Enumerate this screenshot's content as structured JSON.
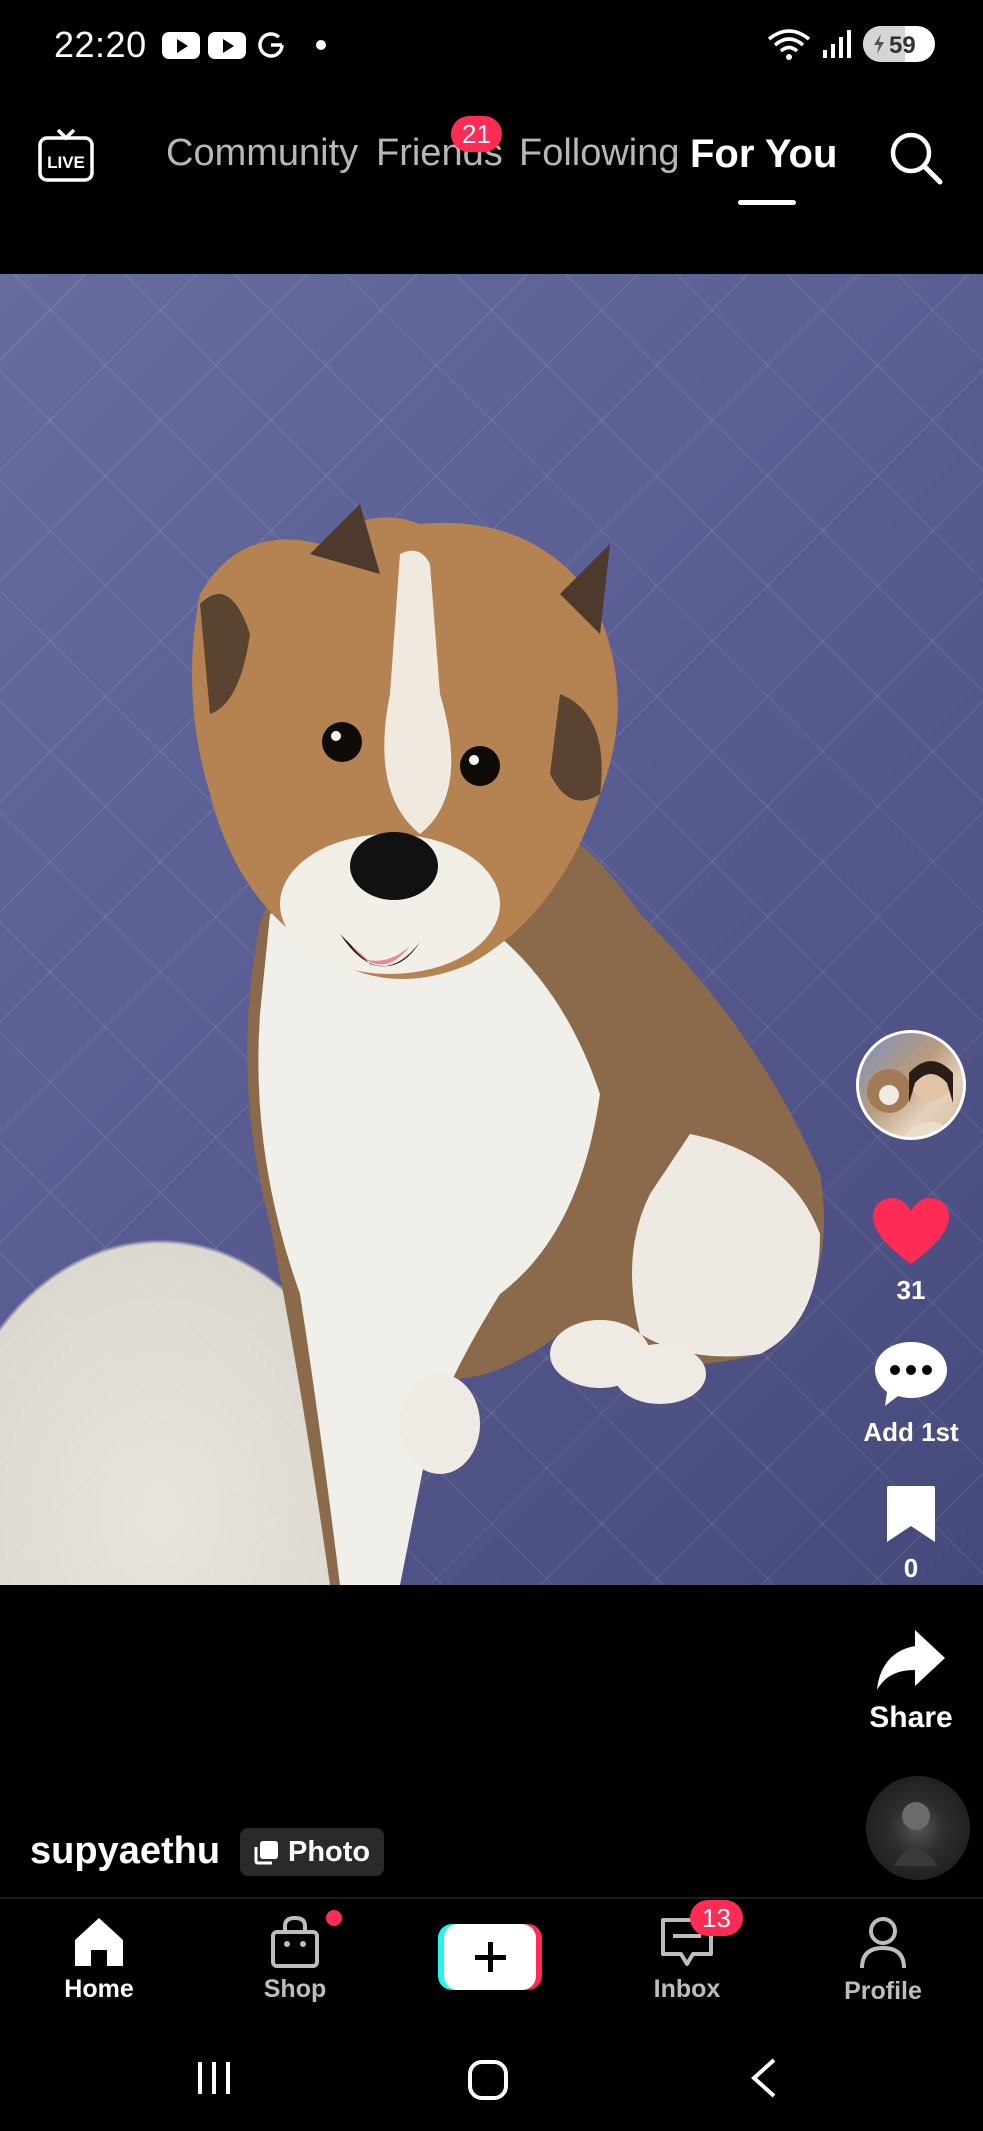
{
  "status_bar": {
    "time": "22:20",
    "battery_level": "59",
    "battery_fraction": 0.59,
    "icons": [
      "youtube-icon",
      "youtube-icon",
      "google-icon",
      "dot-icon",
      "wifi-icon",
      "signal-icon",
      "battery-icon"
    ]
  },
  "top_nav": {
    "live_label": "LIVE",
    "tabs": [
      {
        "label": "Community",
        "active": false
      },
      {
        "label": "Friends",
        "active": false,
        "badge": "21"
      },
      {
        "label": "Following",
        "active": false
      },
      {
        "label": "For You",
        "active": true
      }
    ],
    "search_icon": "search-icon"
  },
  "post": {
    "author": "supyaethu",
    "type_chip": "Photo",
    "likes": "31",
    "comments_label": "Add 1st",
    "saves": "0",
    "share_label": "Share"
  },
  "bottom_nav": {
    "items": [
      {
        "label": "Home",
        "icon": "home-icon",
        "active": true
      },
      {
        "label": "Shop",
        "icon": "shopping-bag-icon",
        "active": false
      },
      {
        "label": "",
        "icon": "plus-icon",
        "active": false
      },
      {
        "label": "Inbox",
        "icon": "message-icon",
        "active": false,
        "badge": "13"
      },
      {
        "label": "Profile",
        "icon": "person-icon",
        "active": false
      }
    ]
  },
  "colors": {
    "accent": "#fe2c55",
    "cyan": "#25f4ee",
    "background": "#000000"
  }
}
